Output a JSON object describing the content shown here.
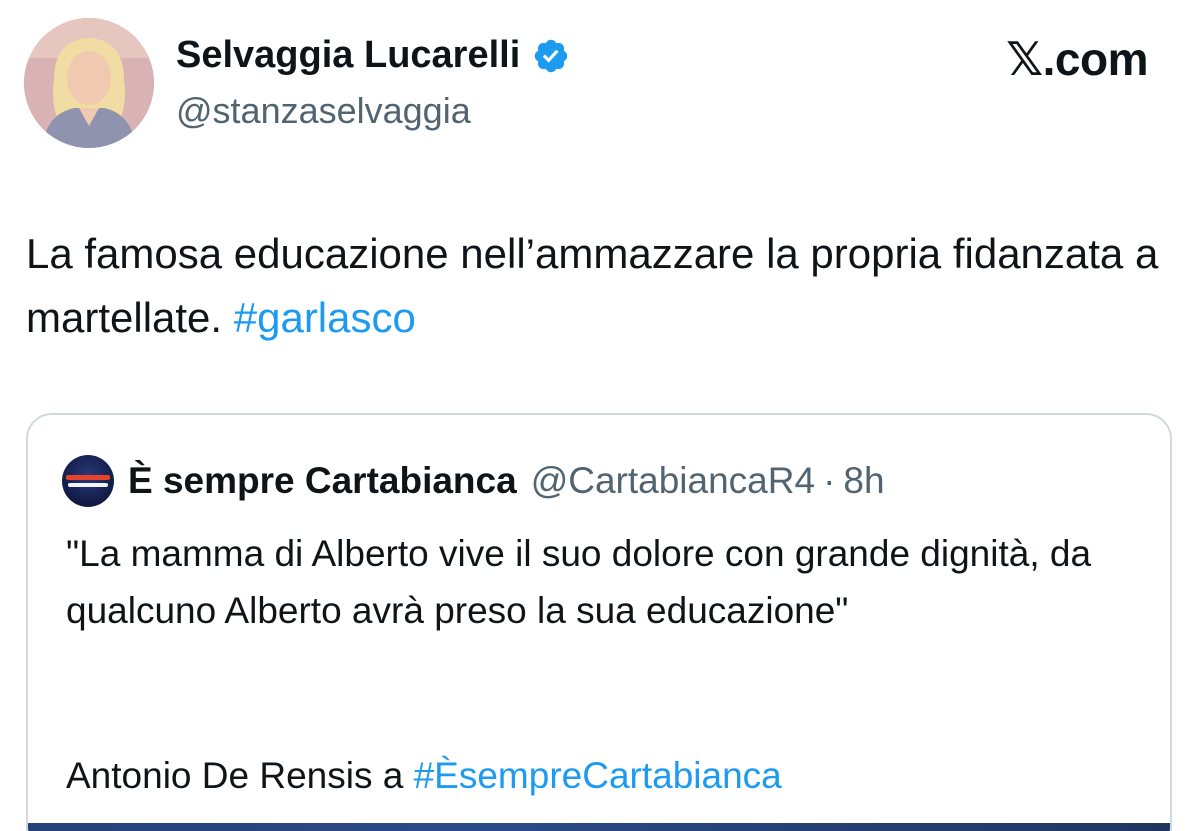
{
  "tweet": {
    "author": {
      "name": "Selvaggia Lucarelli",
      "handle": "@stanzaselvaggia",
      "verified": true
    },
    "site_logo": "𝕏.com",
    "text_before_hashtag": "La famosa educazione nell’ammazzare la propria fidanzata a martellate. ",
    "hashtag": "#garlasco"
  },
  "quoted_tweet": {
    "author_name": "È sempre Cartabianca",
    "author_handle": "@CartabiancaR4",
    "separator": "·",
    "time": "8h",
    "quote_text": "\"La mamma di Alberto vive il suo dolore con grande dignità, da qualcuno Alberto avrà preso la sua educazione\"",
    "credit_prefix": "Antonio De Rensis a ",
    "credit_hashtag": "#ÈsempreCartabianca"
  },
  "colors": {
    "link": "#1d9bf0",
    "secondary_text": "#536471",
    "primary_text": "#0f1419",
    "verified_badge": "#1d9bf0",
    "card_border": "#cfd9de"
  },
  "icons": {
    "verified": "verified-badge-icon"
  }
}
